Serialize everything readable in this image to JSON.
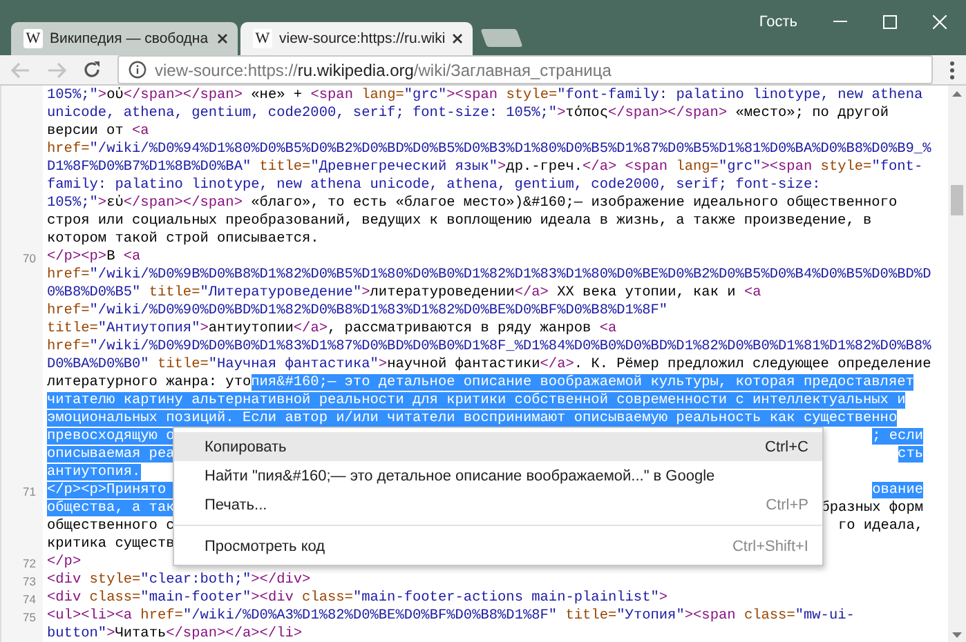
{
  "window": {
    "user": "Гость"
  },
  "tabs": [
    {
      "favicon": "W",
      "title": "Википедия — свободна",
      "selected": false
    },
    {
      "favicon": "W",
      "title": "view-source:https://ru.wiki",
      "selected": true
    }
  ],
  "toolbar": {
    "back_disabled": true,
    "forward_disabled": true
  },
  "address": {
    "scheme": "view-source:https://",
    "host": "ru.wikipedia.org",
    "path": "/wiki/Заглавная_страница"
  },
  "source_lines": [
    {
      "parts": [
        {
          "kind": "value",
          "text": "105%;\""
        },
        {
          "kind": "tag",
          "text": ">"
        },
        {
          "kind": "text",
          "text": "οὐ"
        },
        {
          "kind": "tag",
          "text": "</span></span>"
        },
        {
          "kind": "text",
          "text": " «не» + "
        },
        {
          "kind": "tag",
          "text": "<span "
        },
        {
          "kind": "attr",
          "text": "lang="
        },
        {
          "kind": "value",
          "text": "\"grc\""
        },
        {
          "kind": "tag",
          "text": "><span "
        },
        {
          "kind": "attr",
          "text": "style="
        },
        {
          "kind": "value",
          "text": "\"font-family: palatino linotype, new athena"
        }
      ]
    },
    {
      "parts": [
        {
          "kind": "value",
          "text": "unicode, athena, gentium, code2000, serif; font-size: 105%;\""
        },
        {
          "kind": "tag",
          "text": ">"
        },
        {
          "kind": "text",
          "text": "τόπος"
        },
        {
          "kind": "tag",
          "text": "</span></span>"
        },
        {
          "kind": "text",
          "text": " «место»; по другой"
        }
      ]
    },
    {
      "parts": [
        {
          "kind": "text",
          "text": "версии от "
        },
        {
          "kind": "tag",
          "text": "<a"
        }
      ]
    },
    {
      "parts": [
        {
          "kind": "attr",
          "text": "href="
        },
        {
          "kind": "value",
          "text": "\"/wiki/%D0%94%D1%80%D0%B5%D0%B2%D0%BD%D0%B5%D0%B3%D1%80%D0%B5%D1%87%D0%B5%D1%81%D0%BA%D0%B8%D0%B9_%"
        }
      ]
    },
    {
      "parts": [
        {
          "kind": "value",
          "text": "D1%8F%D0%B7%D1%8B%D0%BA\""
        },
        {
          "kind": "attr",
          "text": " title="
        },
        {
          "kind": "value",
          "text": "\"Древнегреческий язык\""
        },
        {
          "kind": "tag",
          "text": ">"
        },
        {
          "kind": "text",
          "text": "др.-греч."
        },
        {
          "kind": "tag",
          "text": "</a> <span "
        },
        {
          "kind": "attr",
          "text": "lang="
        },
        {
          "kind": "value",
          "text": "\"grc\""
        },
        {
          "kind": "tag",
          "text": "><span "
        },
        {
          "kind": "attr",
          "text": "style="
        },
        {
          "kind": "value",
          "text": "\"font-"
        }
      ]
    },
    {
      "parts": [
        {
          "kind": "value",
          "text": "family: palatino linotype, new athena unicode, athena, gentium, code2000, serif; font-size:"
        }
      ]
    },
    {
      "parts": [
        {
          "kind": "value",
          "text": "105%;\""
        },
        {
          "kind": "tag",
          "text": ">"
        },
        {
          "kind": "text",
          "text": "εὐ"
        },
        {
          "kind": "tag",
          "text": "</span></span>"
        },
        {
          "kind": "text",
          "text": " «благо», то есть «благое место»)&#160;— изображение идеального общественного"
        }
      ]
    },
    {
      "parts": [
        {
          "kind": "text",
          "text": "строя или социальных преобразований, ведущих к воплощению идеала в жизнь, а также произведение, в"
        }
      ]
    },
    {
      "parts": [
        {
          "kind": "text",
          "text": "котором такой строй описывается."
        }
      ]
    },
    {
      "number": "70",
      "parts": [
        {
          "kind": "tag",
          "text": "</p><p>"
        },
        {
          "kind": "text",
          "text": "В "
        },
        {
          "kind": "tag",
          "text": "<a"
        }
      ]
    },
    {
      "parts": [
        {
          "kind": "attr",
          "text": "href="
        },
        {
          "kind": "value",
          "text": "\"/wiki/%D0%9B%D0%B8%D1%82%D0%B5%D1%80%D0%B0%D1%82%D1%83%D1%80%D0%BE%D0%B2%D0%B5%D0%B4%D0%B5%D0%BD%D"
        }
      ]
    },
    {
      "parts": [
        {
          "kind": "value",
          "text": "0%B8%D0%B5\""
        },
        {
          "kind": "attr",
          "text": " title="
        },
        {
          "kind": "value",
          "text": "\"Литературоведение\""
        },
        {
          "kind": "tag",
          "text": ">"
        },
        {
          "kind": "text",
          "text": "литературоведении"
        },
        {
          "kind": "tag",
          "text": "</a>"
        },
        {
          "kind": "text",
          "text": " XX века утопии, как и "
        },
        {
          "kind": "tag",
          "text": "<a"
        }
      ]
    },
    {
      "parts": [
        {
          "kind": "attr",
          "text": "href="
        },
        {
          "kind": "value",
          "text": "\"/wiki/%D0%90%D0%BD%D1%82%D0%B8%D1%83%D1%82%D0%BE%D0%BF%D0%B8%D1%8F\""
        }
      ]
    },
    {
      "parts": [
        {
          "kind": "attr",
          "text": "title="
        },
        {
          "kind": "value",
          "text": "\"Антиутопия\""
        },
        {
          "kind": "tag",
          "text": ">"
        },
        {
          "kind": "text",
          "text": "антиутопии"
        },
        {
          "kind": "tag",
          "text": "</a>"
        },
        {
          "kind": "text",
          "text": ", рассматриваются в ряду жанров "
        },
        {
          "kind": "tag",
          "text": "<a"
        }
      ]
    },
    {
      "parts": [
        {
          "kind": "attr",
          "text": "href="
        },
        {
          "kind": "value",
          "text": "\"/wiki/%D0%9D%D0%B0%D1%83%D1%87%D0%BD%D0%B0%D1%8F_%D1%84%D0%B0%D0%BD%D1%82%D0%B0%D1%81%D1%82%D0%B8%"
        }
      ]
    },
    {
      "parts": [
        {
          "kind": "value",
          "text": "D0%BA%D0%B0\""
        },
        {
          "kind": "attr",
          "text": " title="
        },
        {
          "kind": "value",
          "text": "\"Научная фантастика\""
        },
        {
          "kind": "tag",
          "text": ">"
        },
        {
          "kind": "text",
          "text": "научной фантастики"
        },
        {
          "kind": "tag",
          "text": "</a>"
        },
        {
          "kind": "text",
          "text": ". К. Рёмер предложил следующее определение"
        }
      ]
    },
    {
      "parts": [
        {
          "kind": "text",
          "text": "литературного жанра: уто"
        },
        {
          "kind": "selection",
          "text": "пия&#160;— это детальное описание воображаемой культуры, которая предоставляет"
        }
      ]
    },
    {
      "parts": [
        {
          "kind": "selection",
          "text": "читателю картину альтернативной реальности для критики собственной современности с интеллектуальных и"
        }
      ]
    },
    {
      "parts": [
        {
          "kind": "selection",
          "text": "эмоциональных позиций. Если автор и/или читатели воспринимают описываемую реальность как существенно"
        }
      ]
    },
    {
      "parts": [
        {
          "kind": "selection",
          "text": "превосходящую о"
        }
      ],
      "tail": [
        {
          "kind": "selection",
          "text": "; если"
        }
      ]
    },
    {
      "parts": [
        {
          "kind": "selection",
          "text": "описываемая реа"
        }
      ],
      "tail": [
        {
          "kind": "selection",
          "text": "сть"
        }
      ]
    },
    {
      "parts": [
        {
          "kind": "selection",
          "text": "антиутопия."
        }
      ]
    },
    {
      "number": "71",
      "parts": [
        {
          "kind": "selection",
          "text": "</p><p>Принято "
        }
      ],
      "tail": [
        {
          "kind": "selection",
          "text": "ование"
        }
      ]
    },
    {
      "parts": [
        {
          "kind": "selection",
          "text": "общества, а так"
        }
      ],
      "tail": [
        {
          "kind": "text",
          "text": "бразных форм"
        }
      ]
    },
    {
      "parts": [
        {
          "kind": "text",
          "text": "общественного с"
        }
      ],
      "tail": [
        {
          "kind": "text",
          "text": "го идеала,"
        }
      ]
    },
    {
      "parts": [
        {
          "kind": "text",
          "text": "критика существ"
        }
      ]
    },
    {
      "number": "72",
      "parts": [
        {
          "kind": "tag",
          "text": "</p>"
        }
      ]
    },
    {
      "number": "73",
      "parts": [
        {
          "kind": "tag",
          "text": "<div "
        },
        {
          "kind": "attr",
          "text": "style="
        },
        {
          "kind": "value",
          "text": "\"clear:both;\""
        },
        {
          "kind": "tag",
          "text": "></div>"
        }
      ]
    },
    {
      "number": "74",
      "parts": [
        {
          "kind": "tag",
          "text": "<div "
        },
        {
          "kind": "attr",
          "text": "class="
        },
        {
          "kind": "value",
          "text": "\"main-footer\""
        },
        {
          "kind": "tag",
          "text": "><div "
        },
        {
          "kind": "attr",
          "text": "class="
        },
        {
          "kind": "value",
          "text": "\"main-footer-actions main-plainlist\""
        },
        {
          "kind": "tag",
          "text": ">"
        }
      ]
    },
    {
      "number": "75",
      "parts": [
        {
          "kind": "tag",
          "text": "<ul><li><a "
        },
        {
          "kind": "attr",
          "text": "href="
        },
        {
          "kind": "value",
          "text": "\"/wiki/%D0%A3%D1%82%D0%BE%D0%BF%D0%B8%D1%8F\""
        },
        {
          "kind": "attr",
          "text": " title="
        },
        {
          "kind": "value",
          "text": "\"Утопия\""
        },
        {
          "kind": "tag",
          "text": "><span "
        },
        {
          "kind": "attr",
          "text": "class="
        },
        {
          "kind": "value",
          "text": "\"mw-ui-"
        }
      ]
    },
    {
      "parts": [
        {
          "kind": "value",
          "text": "button\""
        },
        {
          "kind": "tag",
          "text": ">"
        },
        {
          "kind": "text",
          "text": "Читать"
        },
        {
          "kind": "tag",
          "text": "</span></a></li>"
        }
      ]
    }
  ],
  "context_menu": {
    "groups": [
      [
        {
          "label": "Копировать",
          "shortcut": "Ctrl+C",
          "selected": true
        },
        {
          "label": "Найти \"пия&#160;— это детальное описание воображаемой...\" в Google",
          "selected": false
        },
        {
          "label": "Печать...",
          "shortcut": "Ctrl+P",
          "selected": false
        }
      ],
      [
        {
          "label": "Просмотреть код",
          "shortcut": "Ctrl+Shift+I",
          "selected": false
        }
      ]
    ]
  }
}
